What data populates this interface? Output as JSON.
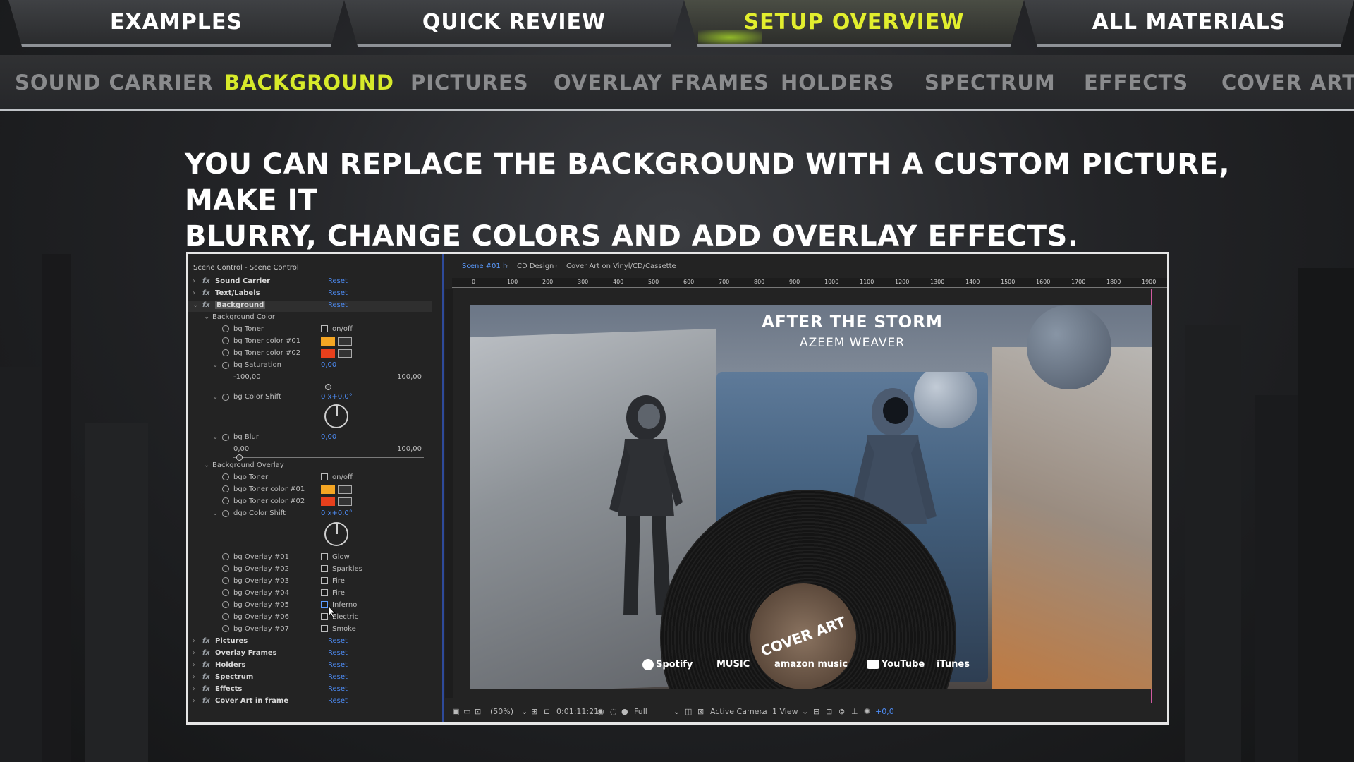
{
  "top_tabs": [
    {
      "label": "EXAMPLES"
    },
    {
      "label": "QUICK REVIEW"
    },
    {
      "label": "SETUP OVERVIEW",
      "active": true
    },
    {
      "label": "ALL MATERIALS"
    }
  ],
  "sub_nav": [
    {
      "label": "SOUND CARRIER"
    },
    {
      "label": "BACKGROUND",
      "active": true
    },
    {
      "label": "PICTURES"
    },
    {
      "label": "OVERLAY FRAMES"
    },
    {
      "label": "HOLDERS"
    },
    {
      "label": "SPECTRUM"
    },
    {
      "label": "EFFECTS"
    },
    {
      "label": "COVER ART"
    }
  ],
  "headline": {
    "line1": "YOU CAN REPLACE THE BACKGROUND WITH A CUSTOM PICTURE, MAKE IT",
    "line2": "BLURRY, CHANGE COLORS AND ADD OVERLAY EFFECTS."
  },
  "colors": {
    "active_tab": "#e2ee2e",
    "active_sub": "#d7ea2a",
    "link_blue": "#4d8cf5",
    "toner_1": "#f5a623",
    "toner_2": "#e8401c"
  },
  "panel": {
    "title": "Scene Control - Scene Control",
    "reset_label": "Reset",
    "groups_top": [
      {
        "label": "Sound Carrier"
      },
      {
        "label": "Text/Labels"
      },
      {
        "label": "Background"
      }
    ],
    "background_color": {
      "label": "Background Color",
      "bg_toner": {
        "label": "bg Toner",
        "value": "on/off"
      },
      "bg_toner_color_01": {
        "label": "bg Toner color #01"
      },
      "bg_toner_color_02": {
        "label": "bg Toner color #02"
      },
      "bg_saturation": {
        "label": "bg Saturation",
        "value": "0,00",
        "min": "-100,00",
        "max": "100,00"
      },
      "bg_color_shift": {
        "label": "bg Color Shift",
        "value": "0 x+0,0°"
      },
      "bg_blur": {
        "label": "bg Blur",
        "value": "0,00",
        "min": "0,00",
        "max": "100,00"
      }
    },
    "background_overlay": {
      "label": "Background Overlay",
      "bgo_toner": {
        "label": "bgo Toner",
        "value": "on/off"
      },
      "bgo_toner_color_01": {
        "label": "bgo Toner color #01"
      },
      "bgo_toner_color_02": {
        "label": "bgo Toner color #02"
      },
      "dgo_color_shift": {
        "label": "dgo Color Shift",
        "value": "0 x+0,0°"
      },
      "overlays": [
        {
          "label": "bg Overlay #01",
          "value": "Glow"
        },
        {
          "label": "bg Overlay #02",
          "value": "Sparkles"
        },
        {
          "label": "bg Overlay #03",
          "value": "Fire"
        },
        {
          "label": "bg Overlay #04",
          "value": "Fire"
        },
        {
          "label": "bg Overlay #05",
          "value": "Inferno"
        },
        {
          "label": "bg Overlay #06",
          "value": "Electric"
        },
        {
          "label": "bg Overlay #07",
          "value": "Smoke"
        }
      ]
    },
    "groups_bottom": [
      {
        "label": "Pictures"
      },
      {
        "label": "Overlay Frames"
      },
      {
        "label": "Holders"
      },
      {
        "label": "Spectrum"
      },
      {
        "label": "Effects"
      },
      {
        "label": "Cover Art in frame"
      }
    ]
  },
  "viewer": {
    "tabs": [
      {
        "label": "Scene #01 h",
        "active": true
      },
      {
        "label": "CD Design"
      },
      {
        "label": "Cover Art on Vinyl/CD/Cassette"
      }
    ],
    "ruler_ticks": [
      "0",
      "100",
      "200",
      "300",
      "400",
      "500",
      "600",
      "700",
      "800",
      "900",
      "1000",
      "1100",
      "1200",
      "1300",
      "1400",
      "1500",
      "1600",
      "1700",
      "1800",
      "1900"
    ],
    "status": {
      "zoom": "(50%)",
      "timecode": "0:01:11:21",
      "resolution": "Full",
      "camera": "Active Camera",
      "views": "1 View",
      "exposure": "+0,0"
    }
  },
  "artwork": {
    "title": "AFTER THE STORM",
    "artist": "AZEEM WEAVER",
    "vinyl_label": "COVER ART",
    "services": [
      "Spotify",
      "MUSIC",
      "amazon music",
      "YouTube",
      "iTunes"
    ]
  }
}
